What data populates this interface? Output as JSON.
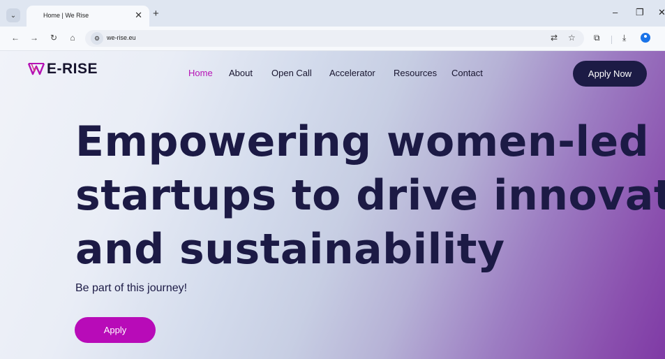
{
  "browser": {
    "tab_title": "Home | We Rise",
    "tab_close": "✕",
    "new_tab": "+",
    "tab_menu": "⌄",
    "url": "we-rise.eu",
    "window_controls": {
      "minimize": "–",
      "restore": "❐",
      "close": "✕"
    },
    "nav_icons": {
      "back": "←",
      "forward": "→",
      "reload": "↻",
      "home": "⌂"
    }
  },
  "site": {
    "logo_text": "E-RISE",
    "nav": [
      "Home",
      "About",
      "Open Call",
      "Accelerator",
      "Resources",
      "Contact"
    ],
    "active_nav": "Home",
    "apply_now": "Apply Now",
    "headline_lines": [
      "Empowering women-led",
      "startups to drive innovation",
      "and sustainability"
    ],
    "subline": "Be part of this journey!",
    "apply": "Apply"
  },
  "colors": {
    "brand_magenta": "#b80bb8",
    "navy": "#1c1a45",
    "gradient_end": "#7f3aa5"
  }
}
